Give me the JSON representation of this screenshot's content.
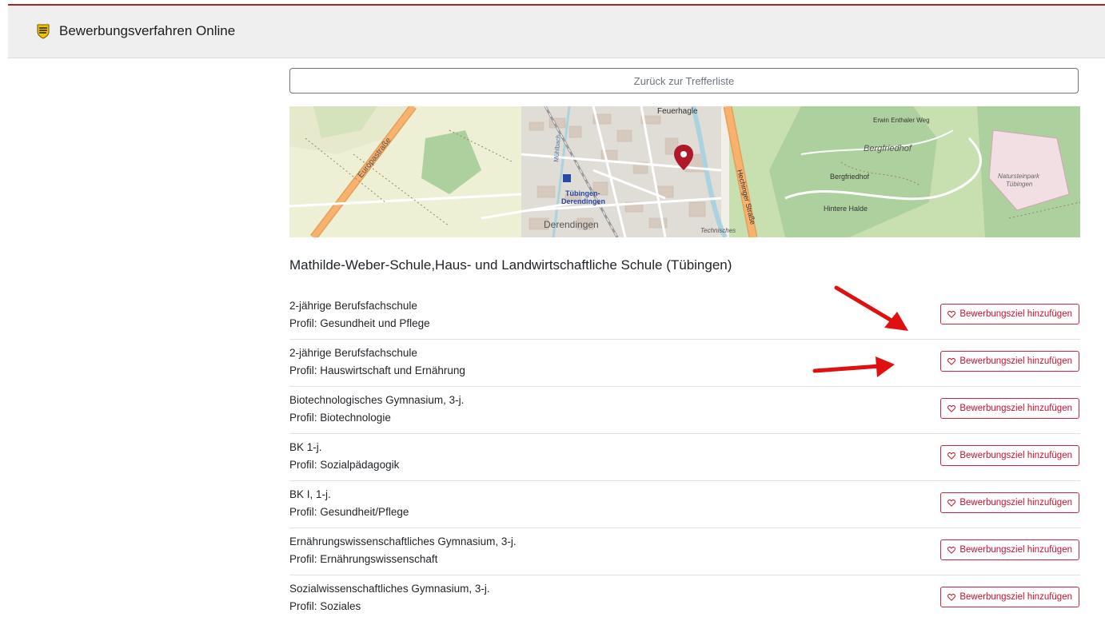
{
  "app": {
    "title": "Bewerbungsverfahren Online"
  },
  "back_button": {
    "label": "Zurück zur Trefferliste"
  },
  "map": {
    "labels": {
      "feuerhagle": "Feuerhagle",
      "europastrasse": "Europastraße",
      "tuebingen_derendingen_1": "Tübingen-",
      "tuebingen_derendingen_2": "Derendingen",
      "derendingen": "Derendingen",
      "bergfriedhof_big": "Bergfriedhof",
      "bergfriedhof_small": "Bergfriedhof",
      "erwin_enthaler_weg": "Erwin Enthaler Weg",
      "hintere_halde": "Hintere Halde",
      "hechinger_strasse": "Hechinger Straße",
      "natursteinpark_1": "Natursteinpark",
      "natursteinpark_2": "Tübingen",
      "technisches": "Technisches",
      "mathildenstrasse": "Mühlbach"
    },
    "colors": {
      "base": "#f2efe9",
      "green": "#c8dfb0",
      "forest": "#add19e",
      "road_major": "#f9b16e",
      "marker": "#b0182a"
    }
  },
  "school": {
    "name": "Mathilde-Weber-Schule,Haus- und Landwirtschaftliche Schule (Tübingen)"
  },
  "add_label": "Bewerbungsziel hinzufügen",
  "programs": [
    {
      "name": "2-jährige Berufsfachschule",
      "profile": "Profil: Gesundheit und Pflege"
    },
    {
      "name": "2-jährige Berufsfachschule",
      "profile": "Profil: Hauswirtschaft und Ernährung"
    },
    {
      "name": "Biotechnologisches Gymnasium, 3-j.",
      "profile": "Profil: Biotechnologie"
    },
    {
      "name": "BK 1-j.",
      "profile": "Profil: Sozialpädagogik"
    },
    {
      "name": "BK I, 1-j.",
      "profile": "Profil: Gesundheit/Pflege"
    },
    {
      "name": "Ernährungswissenschaftliches Gymnasium, 3-j.",
      "profile": "Profil: Ernährungswissenschaft"
    },
    {
      "name": "Sozialwissenschaftliches Gymnasium, 3-j.",
      "profile": "Profil: Soziales"
    }
  ],
  "annotations": {
    "arrow_color": "#e01010"
  }
}
